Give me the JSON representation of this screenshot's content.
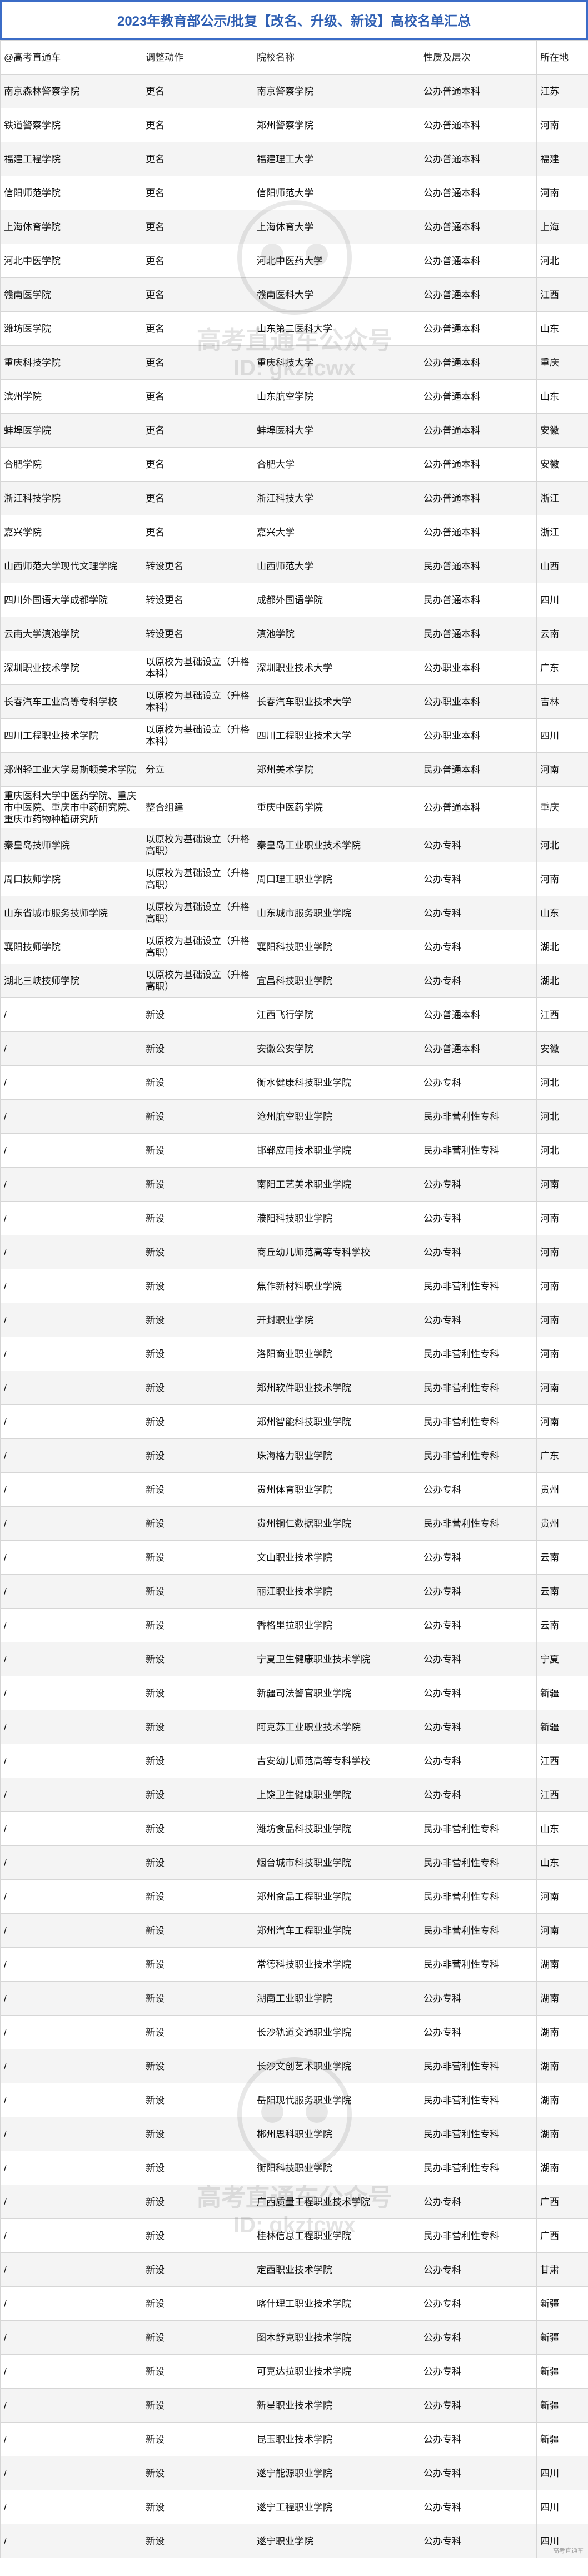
{
  "title": "2023年教育部公示/批复【改名、升级、新设】高校名单汇总",
  "headers": [
    "@高考直通车",
    "调整动作",
    "院校名称",
    "性质及层次",
    "所在地"
  ],
  "rows": [
    [
      "南京森林警察学院",
      "更名",
      "南京警察学院",
      "公办普通本科",
      "江苏"
    ],
    [
      "铁道警察学院",
      "更名",
      "郑州警察学院",
      "公办普通本科",
      "河南"
    ],
    [
      "福建工程学院",
      "更名",
      "福建理工大学",
      "公办普通本科",
      "福建"
    ],
    [
      "信阳师范学院",
      "更名",
      "信阳师范大学",
      "公办普通本科",
      "河南"
    ],
    [
      "上海体育学院",
      "更名",
      "上海体育大学",
      "公办普通本科",
      "上海"
    ],
    [
      "河北中医学院",
      "更名",
      "河北中医药大学",
      "公办普通本科",
      "河北"
    ],
    [
      "赣南医学院",
      "更名",
      "赣南医科大学",
      "公办普通本科",
      "江西"
    ],
    [
      "潍坊医学院",
      "更名",
      "山东第二医科大学",
      "公办普通本科",
      "山东"
    ],
    [
      "重庆科技学院",
      "更名",
      "重庆科技大学",
      "公办普通本科",
      "重庆"
    ],
    [
      "滨州学院",
      "更名",
      "山东航空学院",
      "公办普通本科",
      "山东"
    ],
    [
      "蚌埠医学院",
      "更名",
      "蚌埠医科大学",
      "公办普通本科",
      "安徽"
    ],
    [
      "合肥学院",
      "更名",
      "合肥大学",
      "公办普通本科",
      "安徽"
    ],
    [
      "浙江科技学院",
      "更名",
      "浙江科技大学",
      "公办普通本科",
      "浙江"
    ],
    [
      "嘉兴学院",
      "更名",
      "嘉兴大学",
      "公办普通本科",
      "浙江"
    ],
    [
      "山西师范大学现代文理学院",
      "转设更名",
      "山西师范大学",
      "民办普通本科",
      "山西"
    ],
    [
      "四川外国语大学成都学院",
      "转设更名",
      "成都外国语学院",
      "民办普通本科",
      "四川"
    ],
    [
      "云南大学滇池学院",
      "转设更名",
      "滇池学院",
      "民办普通本科",
      "云南"
    ],
    [
      "深圳职业技术学院",
      "以原校为基础设立（升格本科）",
      "深圳职业技术大学",
      "公办职业本科",
      "广东"
    ],
    [
      "长春汽车工业高等专科学校",
      "以原校为基础设立（升格本科）",
      "长春汽车职业技术大学",
      "公办职业本科",
      "吉林"
    ],
    [
      "四川工程职业技术学院",
      "以原校为基础设立（升格本科）",
      "四川工程职业技术大学",
      "公办职业本科",
      "四川"
    ],
    [
      "郑州轻工业大学易斯顿美术学院",
      "分立",
      "郑州美术学院",
      "民办普通本科",
      "河南"
    ],
    [
      "重庆医科大学中医药学院、重庆市中医院、重庆市中药研究院、重庆市药物种植研究所",
      "整合组建",
      "重庆中医药学院",
      "公办普通本科",
      "重庆"
    ],
    [
      "秦皇岛技师学院",
      "以原校为基础设立（升格高职）",
      "秦皇岛工业职业技术学院",
      "公办专科",
      "河北"
    ],
    [
      "周口技师学院",
      "以原校为基础设立（升格高职）",
      "周口理工职业学院",
      "公办专科",
      "河南"
    ],
    [
      "山东省城市服务技师学院",
      "以原校为基础设立（升格高职）",
      "山东城市服务职业学院",
      "公办专科",
      "山东"
    ],
    [
      "襄阳技师学院",
      "以原校为基础设立（升格高职）",
      "襄阳科技职业学院",
      "公办专科",
      "湖北"
    ],
    [
      "湖北三峡技师学院",
      "以原校为基础设立（升格高职）",
      "宜昌科技职业学院",
      "公办专科",
      "湖北"
    ],
    [
      "/",
      "新设",
      "江西飞行学院",
      "公办普通本科",
      "江西"
    ],
    [
      "/",
      "新设",
      "安徽公安学院",
      "公办普通本科",
      "安徽"
    ],
    [
      "/",
      "新设",
      "衡水健康科技职业学院",
      "公办专科",
      "河北"
    ],
    [
      "/",
      "新设",
      "沧州航空职业学院",
      "民办非营利性专科",
      "河北"
    ],
    [
      "/",
      "新设",
      "邯郸应用技术职业学院",
      "民办非营利性专科",
      "河北"
    ],
    [
      "/",
      "新设",
      "南阳工艺美术职业学院",
      "公办专科",
      "河南"
    ],
    [
      "/",
      "新设",
      "濮阳科技职业学院",
      "公办专科",
      "河南"
    ],
    [
      "/",
      "新设",
      "商丘幼儿师范高等专科学校",
      "公办专科",
      "河南"
    ],
    [
      "/",
      "新设",
      "焦作新材料职业学院",
      "民办非营利性专科",
      "河南"
    ],
    [
      "/",
      "新设",
      "开封职业学院",
      "公办专科",
      "河南"
    ],
    [
      "/",
      "新设",
      "洛阳商业职业学院",
      "民办非营利性专科",
      "河南"
    ],
    [
      "/",
      "新设",
      "郑州软件职业技术学院",
      "民办非营利性专科",
      "河南"
    ],
    [
      "/",
      "新设",
      "郑州智能科技职业学院",
      "民办非营利性专科",
      "河南"
    ],
    [
      "/",
      "新设",
      "珠海格力职业学院",
      "民办非营利性专科",
      "广东"
    ],
    [
      "/",
      "新设",
      "贵州体育职业学院",
      "公办专科",
      "贵州"
    ],
    [
      "/",
      "新设",
      "贵州铜仁数据职业学院",
      "民办非营利性专科",
      "贵州"
    ],
    [
      "/",
      "新设",
      "文山职业技术学院",
      "公办专科",
      "云南"
    ],
    [
      "/",
      "新设",
      "丽江职业技术学院",
      "公办专科",
      "云南"
    ],
    [
      "/",
      "新设",
      "香格里拉职业学院",
      "公办专科",
      "云南"
    ],
    [
      "/",
      "新设",
      "宁夏卫生健康职业技术学院",
      "公办专科",
      "宁夏"
    ],
    [
      "/",
      "新设",
      "新疆司法警官职业学院",
      "公办专科",
      "新疆"
    ],
    [
      "/",
      "新设",
      "阿克苏工业职业技术学院",
      "公办专科",
      "新疆"
    ],
    [
      "/",
      "新设",
      "吉安幼儿师范高等专科学校",
      "公办专科",
      "江西"
    ],
    [
      "/",
      "新设",
      "上饶卫生健康职业学院",
      "公办专科",
      "江西"
    ],
    [
      "/",
      "新设",
      "潍坊食品科技职业学院",
      "民办非营利性专科",
      "山东"
    ],
    [
      "/",
      "新设",
      "烟台城市科技职业学院",
      "民办非营利性专科",
      "山东"
    ],
    [
      "/",
      "新设",
      "郑州食品工程职业学院",
      "民办非营利性专科",
      "河南"
    ],
    [
      "/",
      "新设",
      "郑州汽车工程职业学院",
      "民办非营利性专科",
      "河南"
    ],
    [
      "/",
      "新设",
      "常德科技职业技术学院",
      "民办非营利性专科",
      "湖南"
    ],
    [
      "/",
      "新设",
      "湖南工业职业学院",
      "公办专科",
      "湖南"
    ],
    [
      "/",
      "新设",
      "长沙轨道交通职业学院",
      "公办专科",
      "湖南"
    ],
    [
      "/",
      "新设",
      "长沙文创艺术职业学院",
      "民办非营利性专科",
      "湖南"
    ],
    [
      "/",
      "新设",
      "岳阳现代服务职业学院",
      "民办非营利性专科",
      "湖南"
    ],
    [
      "/",
      "新设",
      "郴州思科职业学院",
      "民办非营利性专科",
      "湖南"
    ],
    [
      "/",
      "新设",
      "衡阳科技职业学院",
      "民办非营利性专科",
      "湖南"
    ],
    [
      "/",
      "新设",
      "广西质量工程职业技术学院",
      "公办专科",
      "广西"
    ],
    [
      "/",
      "新设",
      "桂林信息工程职业学院",
      "民办非营利性专科",
      "广西"
    ],
    [
      "/",
      "新设",
      "定西职业技术学院",
      "公办专科",
      "甘肃"
    ],
    [
      "/",
      "新设",
      "喀什理工职业技术学院",
      "公办专科",
      "新疆"
    ],
    [
      "/",
      "新设",
      "图木舒克职业技术学院",
      "公办专科",
      "新疆"
    ],
    [
      "/",
      "新设",
      "可克达拉职业技术学院",
      "公办专科",
      "新疆"
    ],
    [
      "/",
      "新设",
      "新星职业技术学院",
      "公办专科",
      "新疆"
    ],
    [
      "/",
      "新设",
      "昆玉职业技术学院",
      "公办专科",
      "新疆"
    ],
    [
      "/",
      "新设",
      "遂宁能源职业学院",
      "公办专科",
      "四川"
    ],
    [
      "/",
      "新设",
      "遂宁工程职业学院",
      "公办专科",
      "四川"
    ],
    [
      "/",
      "新设",
      "遂宁职业学院",
      "公办专科",
      "四川"
    ]
  ],
  "watermark": {
    "line1": "高考直通车公众号",
    "line2": "ID: gkztcwx"
  },
  "corner_text": "高考直通车"
}
